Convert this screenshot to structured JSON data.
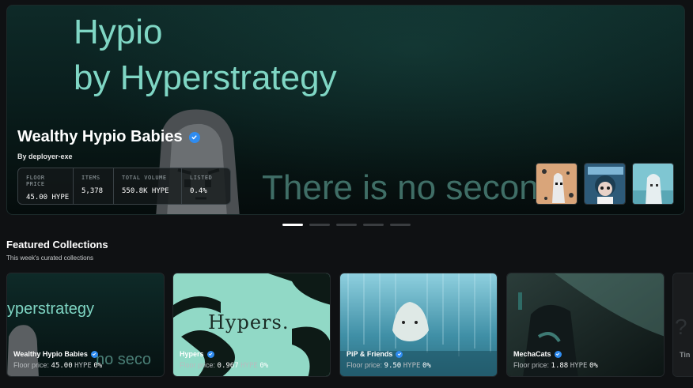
{
  "hero": {
    "bg_line1": "Hypio",
    "bg_line2": "by Hyperstrategy",
    "bg_slogan": "There is no second",
    "title": "Wealthy Hypio Babies",
    "creator": "By deployer-exe",
    "stats": [
      {
        "label": "FLOOR PRICE",
        "value": "45.00 HYPE"
      },
      {
        "label": "ITEMS",
        "value": "5,378"
      },
      {
        "label": "TOTAL VOLUME",
        "value": "550.8K HYPE"
      },
      {
        "label": "LISTED",
        "value": "0.4%"
      }
    ]
  },
  "carousel": {
    "count": 5,
    "active": 1
  },
  "featured": {
    "title": "Featured Collections",
    "subtitle": "This week's curated collections",
    "price_prefix": "Floor price:",
    "cards": [
      {
        "name": "Wealthy Hypio Babies",
        "price": "45.00",
        "unit": "HYPE",
        "change": "0%",
        "banner_text": "yperstrategy",
        "banner_slogan": "no seco"
      },
      {
        "name": "Hypers",
        "price": "0.967",
        "unit": "HYPE",
        "change": "0%",
        "banner_text": "Hypers."
      },
      {
        "name": "PiP & Friends",
        "price": "9.50",
        "unit": "HYPE",
        "change": "0%"
      },
      {
        "name": "MechaCats",
        "price": "1.88",
        "unit": "HYPE",
        "change": "0%"
      },
      {
        "name": "Tin",
        "banner_text": "?"
      }
    ]
  },
  "colors": {
    "accent": "#2f8cf0",
    "hero_text": "#7fd6c4",
    "bg": "#0f1113"
  },
  "icons": [
    "verified-badge-icon"
  ]
}
